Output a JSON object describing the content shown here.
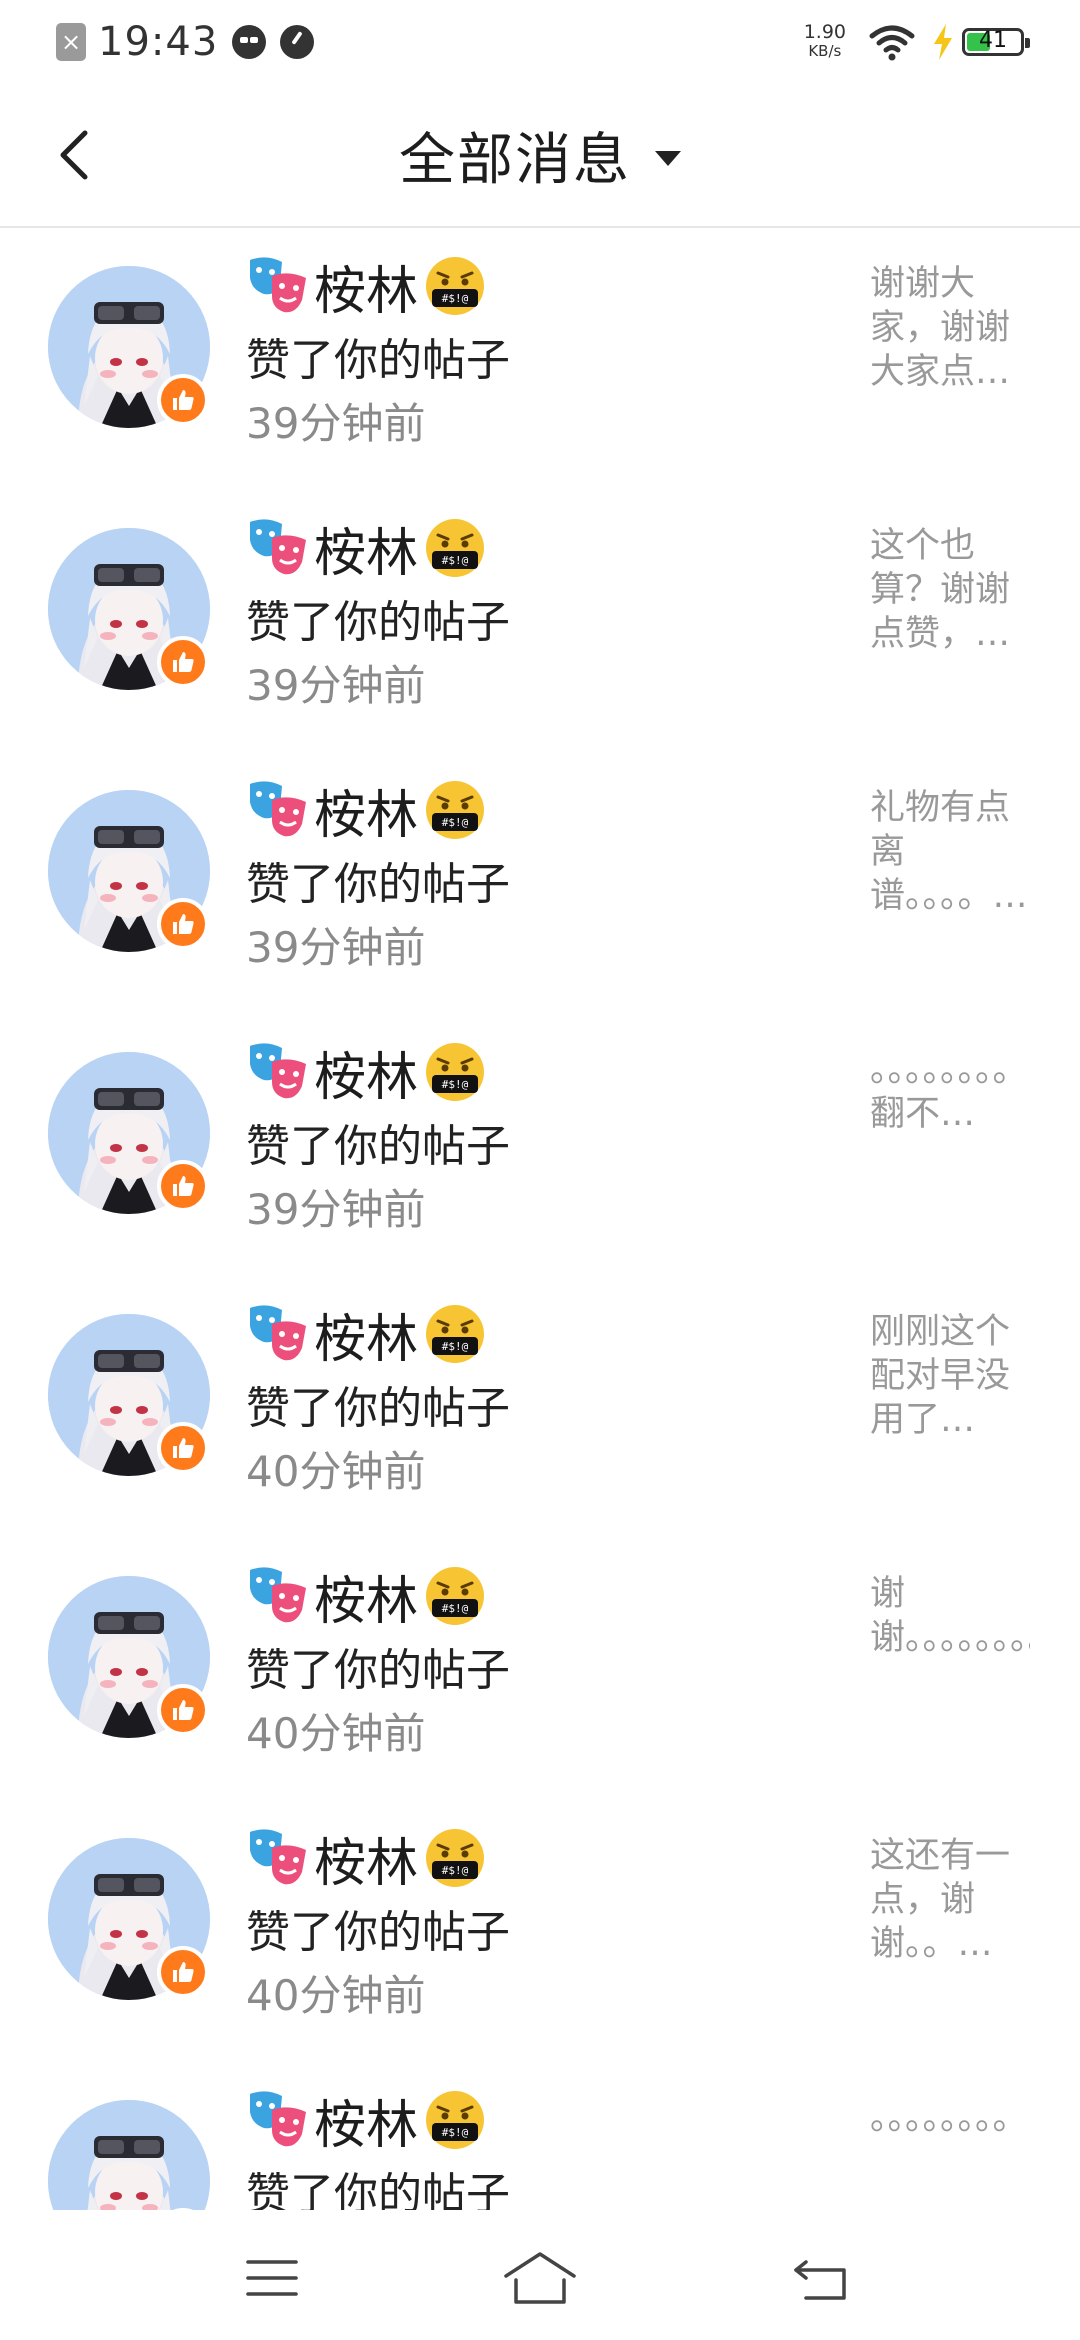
{
  "status_bar": {
    "time": "19:43",
    "net_speed": "1.90",
    "net_unit": "KB/s",
    "battery": "41",
    "battery_color": "#34c24a",
    "icons": [
      "close-icon",
      "cat-icon",
      "gauge-icon",
      "wifi-icon",
      "charging-icon",
      "battery-icon"
    ]
  },
  "header": {
    "back_icon": "chevron-left-icon",
    "title": "全部消息",
    "dropdown_icon": "caret-down-icon"
  },
  "messages": [
    {
      "name": "桉林",
      "action": "赞了你的帖子",
      "time": "39分钟前",
      "preview": "谢谢大家，谢谢大家点…"
    },
    {
      "name": "桉林",
      "action": "赞了你的帖子",
      "time": "39分钟前",
      "preview": "这个也算？谢谢点赞，…"
    },
    {
      "name": "桉林",
      "action": "赞了你的帖子",
      "time": "39分钟前",
      "preview": "礼物有点离谱。。。。…"
    },
    {
      "name": "桉林",
      "action": "赞了你的帖子",
      "time": "39分钟前",
      "preview": "。。。。。。。。翻不…"
    },
    {
      "name": "桉林",
      "action": "赞了你的帖子",
      "time": "40分钟前",
      "preview": "刚刚这个配对早没用了…"
    },
    {
      "name": "桉林",
      "action": "赞了你的帖子",
      "time": "40分钟前",
      "preview": "谢谢。。。。。。。。…"
    },
    {
      "name": "桉林",
      "action": "赞了你的帖子",
      "time": "40分钟前",
      "preview": "这还有一点，谢谢。。…"
    },
    {
      "name": "桉林",
      "action": "赞了你的帖子",
      "time": "",
      "preview": "。。。。。。。。"
    }
  ],
  "colors": {
    "like_badge": "#ff7a1a",
    "avatar_bg": "#b9d3f5"
  },
  "nav": {
    "icons": [
      "menu-icon",
      "home-icon",
      "back-icon"
    ]
  }
}
